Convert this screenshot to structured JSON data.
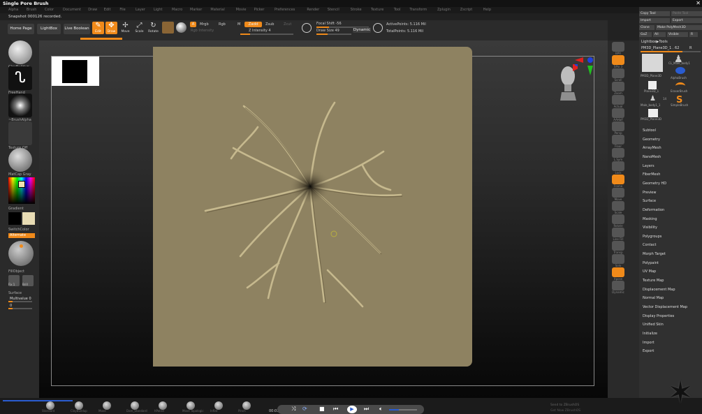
{
  "window": {
    "title": "Single Pore Brush",
    "close_glyph": "✕"
  },
  "menubar": [
    "Alpha",
    "Brush",
    "Color",
    "Document",
    "Draw",
    "Edit",
    "File",
    "Layer",
    "Light",
    "Macro",
    "Marker",
    "Material",
    "Movie",
    "Picker",
    "Preferences",
    "Render",
    "Stencil",
    "Stroke",
    "Texture",
    "Tool",
    "Transform",
    "Zplugin",
    "Zscript",
    "Help"
  ],
  "status": {
    "message": "Snapshot 000126 recorded."
  },
  "toolbar": {
    "home_page": "Home Page",
    "lightbox": "LightBox",
    "live_boolean": "Live Boolean",
    "edit": "Edit",
    "draw": "Draw",
    "move": "Move",
    "scale": "Scale",
    "rotate": "Rotate",
    "a_label": "A",
    "mrgb": "Mrgb",
    "rgb": "Rgb",
    "m": "M",
    "rgb_intensity": "Rgb Intensity",
    "zadd": "Zadd",
    "zsub": "Zsub",
    "zcut": "Zcut",
    "z_intensity": "Z Intensity 4",
    "focal_shift": "Focal Shift -56",
    "draw_size": "Draw Size 49",
    "dynamic": "Dynamic",
    "active_points": "ActivePoints: 5.116 Mil",
    "total_points": "TotalPoints: 5.116 Mil",
    "accent": "#f08a1a"
  },
  "leftpanel": {
    "brush": "ClayBuildup",
    "stroke": "FreeHand",
    "alpha": "~BrushAlpha",
    "texture": "Texture Off",
    "material": "MatCap Gray",
    "gradient": "Gradient",
    "switch_color": "SwitchColor",
    "alternate": "Alternate",
    "fill_object": "FillObject",
    "fix1": "Fix 1",
    "brill": "Brill",
    "surface": "Surface",
    "multivalue": "Multivalue 0",
    "zero": "0"
  },
  "rightstrip": [
    "BPR",
    "SPix 3",
    "Scroll",
    "Zoom",
    "Actual",
    "AAHalf",
    "Persp",
    "Floor",
    "L.Sym",
    "Lock",
    "Frame",
    "Move",
    "Scale",
    "Rotate",
    "Line Fill",
    "Transp",
    "Solo",
    "Xpose",
    "Dynamic"
  ],
  "tray": {
    "copy_tool": "Copy Tool",
    "paste_tool": "Paste Tool",
    "import": "Import",
    "export": "Export",
    "clone": "Clone",
    "make_polymesh": "Make PolyMesh3D",
    "goz": "GoZ",
    "all": "All",
    "visible": "Visible",
    "r": "R",
    "lightbox_tools": "Lightbox▶Tools",
    "current_tool": "PM3D_Plane3D_1 . 62",
    "r2": "R",
    "thumbs": [
      "PM3D_Plane3D",
      "CL_Male_body1",
      "AlphaBrush",
      "Plane3D_1",
      "EraserBrush",
      "Male_body1_1",
      "SimpleBrush",
      "PM3D_Plane3D"
    ],
    "count": "14",
    "menus": [
      "Subtool",
      "Geometry",
      "ArrayMesh",
      "NanoMesh",
      "Layers",
      "FiberMesh",
      "Geometry HD",
      "Preview",
      "Surface",
      "Deformation",
      "Masking",
      "Visibility",
      "Polygroups",
      "Contact",
      "Morph Target",
      "Polypaint",
      "UV Map",
      "Texture Map",
      "Displacement Map",
      "Normal Map",
      "Vector Displacement Map",
      "Display Properties",
      "Unified Skin",
      "Initialize",
      "Import",
      "Export"
    ]
  },
  "bottombar": {
    "brushes": [
      "Standard",
      "ClayBuildup",
      "Move",
      "Dam_Standard",
      "hPolish",
      "Move Topologic",
      "Inflat",
      "Pinch"
    ],
    "time": "00:01",
    "send": "Send to ZBrushOS",
    "see": "Get Now ZBrushOS"
  }
}
